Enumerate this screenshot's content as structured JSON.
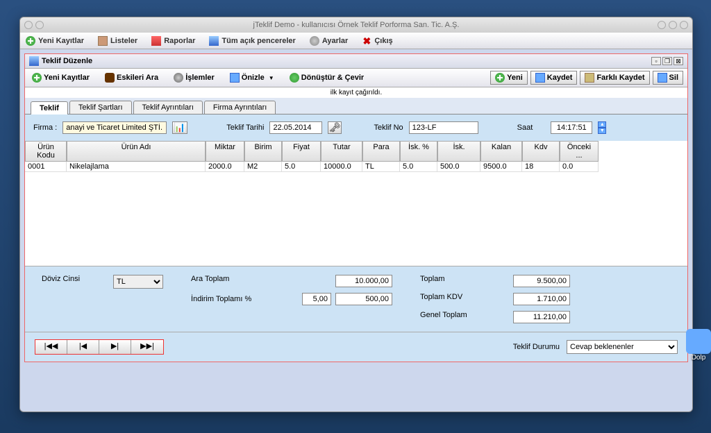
{
  "window_title": "jTeklif   Demo  -  kullanıcısı   Örnek Teklif Porforma San. Tic. A.Ş.",
  "main_menu": {
    "yeni": "Yeni Kayıtlar",
    "listeler": "Listeler",
    "raporlar": "Raporlar",
    "pencereler": "Tüm açık pencereler",
    "ayarlar": "Ayarlar",
    "cikis": "Çıkış"
  },
  "sub": {
    "title": "Teklif Düzenle",
    "toolbar": {
      "yeni": "Yeni Kayıtlar",
      "eskileri": "Eskileri Ara",
      "islemler": "İşlemler",
      "onizle": "Önizle",
      "donustur": "Dönüştür & Çevir"
    },
    "actions": {
      "yeni": "Yeni",
      "kaydet": "Kaydet",
      "farkli": "Farklı Kaydet",
      "sil": "Sil"
    },
    "status": "ilk kayıt çağırıldı."
  },
  "tabs": [
    "Teklif",
    "Teklif Şartları",
    "Teklif Ayrıntıları",
    "Firma Ayrıntıları"
  ],
  "form": {
    "firma_label": "Firma :",
    "firma_value": "anayi ve Ticaret Limited ŞTİ.",
    "tarih_label": "Teklif Tarihi",
    "tarih_value": "22.05.2014",
    "no_label": "Teklif No",
    "no_value": "123-LF",
    "saat_label": "Saat",
    "saat_value": "14:17:51"
  },
  "grid": {
    "headers": [
      "Ürün Kodu",
      "Ürün Adı",
      "Miktar",
      "Birim",
      "Fiyat",
      "Tutar",
      "Para",
      "İsk. %",
      "İsk.",
      "Kalan",
      "Kdv",
      "Önceki ..."
    ],
    "row": [
      "0001",
      "Nikelajlama",
      "2000.0",
      "M2",
      "5.0",
      "10000.0",
      "TL",
      "5.0",
      "500.0",
      "9500.0",
      "18",
      "0.0"
    ]
  },
  "totals": {
    "doviz_label": "Döviz Cinsi",
    "doviz_value": "TL",
    "ara_label": "Ara Toplam",
    "ara_value": "10.000,00",
    "indirim_label": "İndirim Toplamı  %",
    "indirim_pct": "5,00",
    "indirim_val": "500,00",
    "toplam_label": "Toplam",
    "toplam_val": "9.500,00",
    "kdv_label": "Toplam KDV",
    "kdv_val": "1.710,00",
    "genel_label": "Genel Toplam",
    "genel_val": "11.210,00"
  },
  "footer": {
    "durum_label": "Teklif Durumu",
    "durum_value": "Cevap beklenenler"
  },
  "desktop_icon": "Dolp"
}
